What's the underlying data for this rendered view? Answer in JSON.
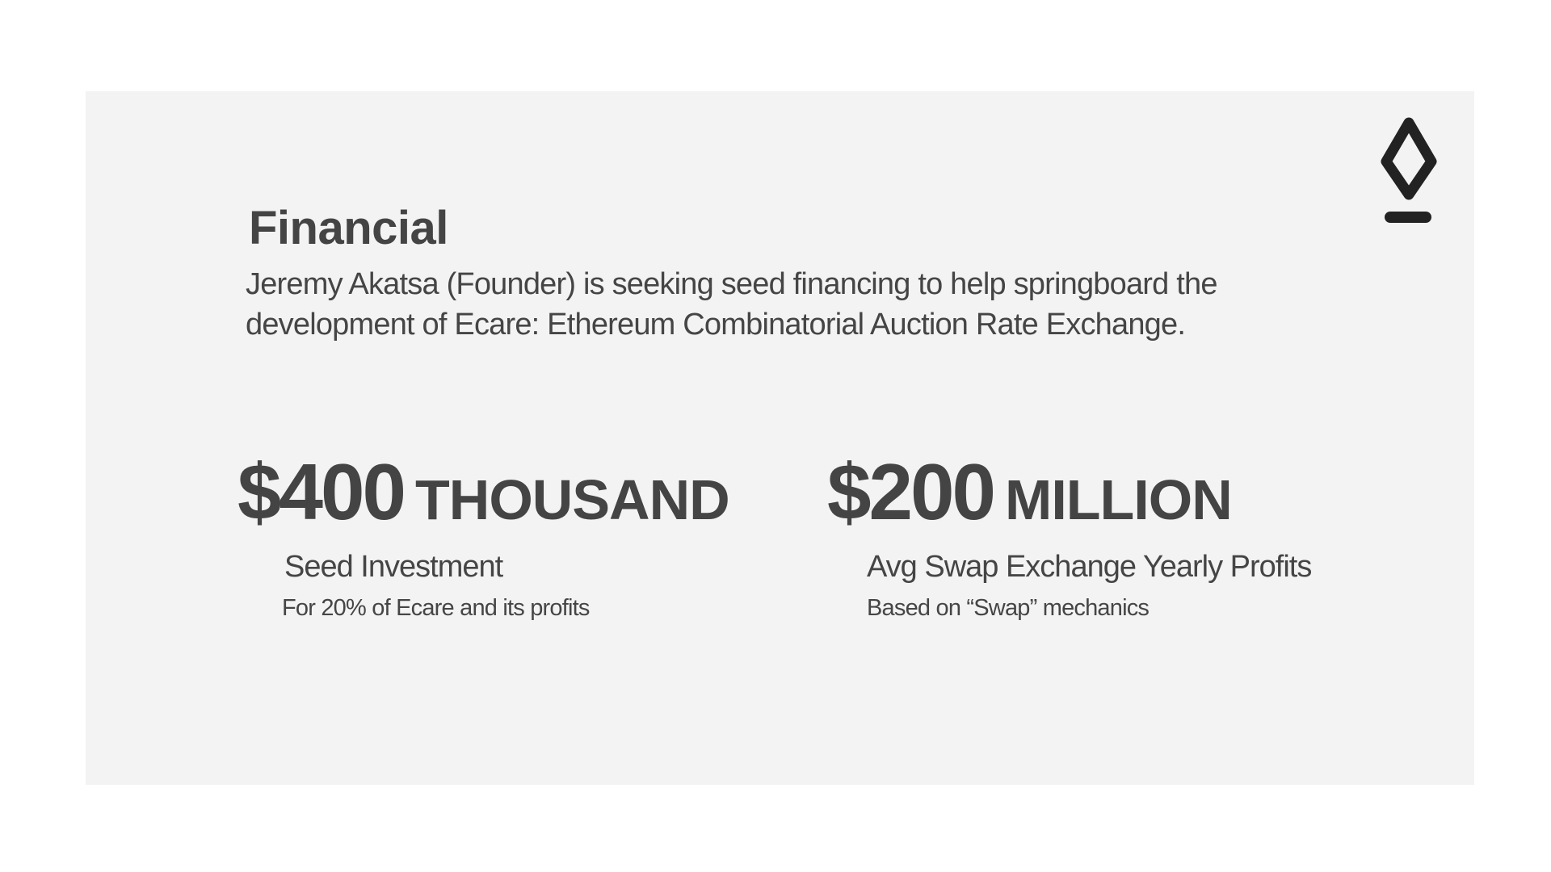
{
  "slide": {
    "title": "Financial",
    "intro": "Jeremy Akatsa (Founder) is seeking seed financing to help springboard the development of Ecare: Ethereum Combinatorial Auction Rate Exchange.",
    "logo_icon": "diamond-logo-icon",
    "stats": [
      {
        "value": "$400",
        "unit": "THOUSAND",
        "label": "Seed Investment",
        "note": "For 20% of Ecare and its profits"
      },
      {
        "value": "$200",
        "unit": "MILLION",
        "label": "Avg Swap Exchange Yearly Profits",
        "note": "Based on “Swap” mechanics"
      }
    ]
  },
  "colors": {
    "slide_background": "#f3f3f3",
    "text": "#444444",
    "logo": "#222222"
  }
}
